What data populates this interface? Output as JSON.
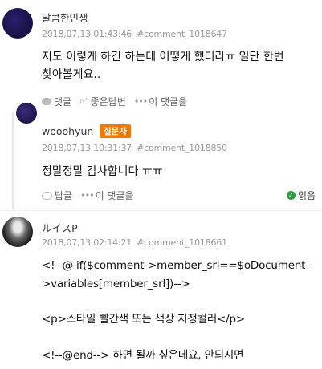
{
  "comments": [
    {
      "author": "달콤한인생",
      "date": "2018,07,13 01:43:46",
      "permalink": "#comment_1018647",
      "body": [
        "저도 이렇게 하긴 하는데 어떻게 했더라ㅠ 일단 한번",
        "찾아볼게요.."
      ],
      "actions": {
        "reply": "댓글",
        "helpful": "좋은답변",
        "more": "이 댓글을"
      }
    },
    {
      "author": "wooohyun",
      "badge": "질문자",
      "date": "2018,07,13 10:31:37",
      "permalink": "#comment_1018850",
      "body": [
        "정말정말 감사합니다 ㅠㅠ"
      ],
      "actions": {
        "reply": "답글",
        "more": "이 댓글을",
        "read": "읽음"
      }
    },
    {
      "author": "ルイスP",
      "date": "2018,07,13 02:14:21",
      "permalink": "#comment_1018661",
      "body": [
        "<!--@ if($comment->member_srl==$oDocument-",
        ">variables[member_srl])-->",
        "",
        "<p>스타일 빨간색 또는 색상 지정컬러</p>",
        "",
        "<!--@end--> 하면 될까 싶은데요, 안되시면"
      ]
    }
  ],
  "colors": {
    "badge": "#f07a00",
    "read_check": "#2a9d3a"
  }
}
